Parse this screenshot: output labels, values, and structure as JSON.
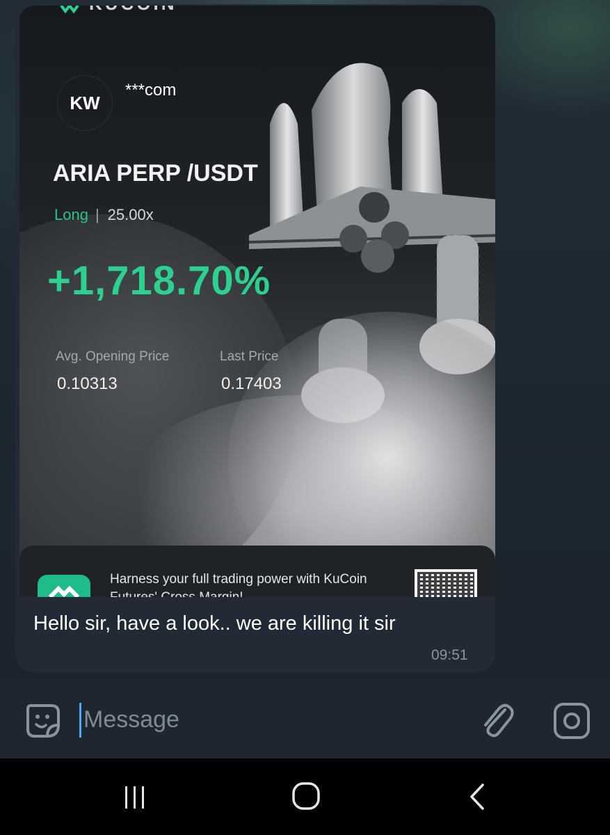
{
  "post": {
    "brand_fragment": "KUCOIN",
    "avatar_initials": "KW",
    "account": "***com",
    "pair": "ARIA PERP /USDT",
    "side": "Long",
    "separator": "|",
    "leverage": "25.00x",
    "pnl": "+1,718.70%",
    "avg_open_label": "Avg. Opening Price",
    "avg_open_value": "0.10313",
    "last_price_label": "Last Price",
    "last_price_value": "0.17403",
    "promo_text": "Harness your full trading power with KuCoin Futures' Cross Margin!",
    "accent_color": "#2cd08f"
  },
  "message": {
    "text": "Hello sir, have a look.. we are killing it sir",
    "time": "09:51"
  },
  "composer": {
    "placeholder": "Message"
  },
  "icons": {
    "sticker": "sticker-icon",
    "attach": "paperclip-icon",
    "camera": "camera-icon",
    "recent": "recent-apps-icon",
    "home": "home-icon",
    "back": "back-icon"
  }
}
